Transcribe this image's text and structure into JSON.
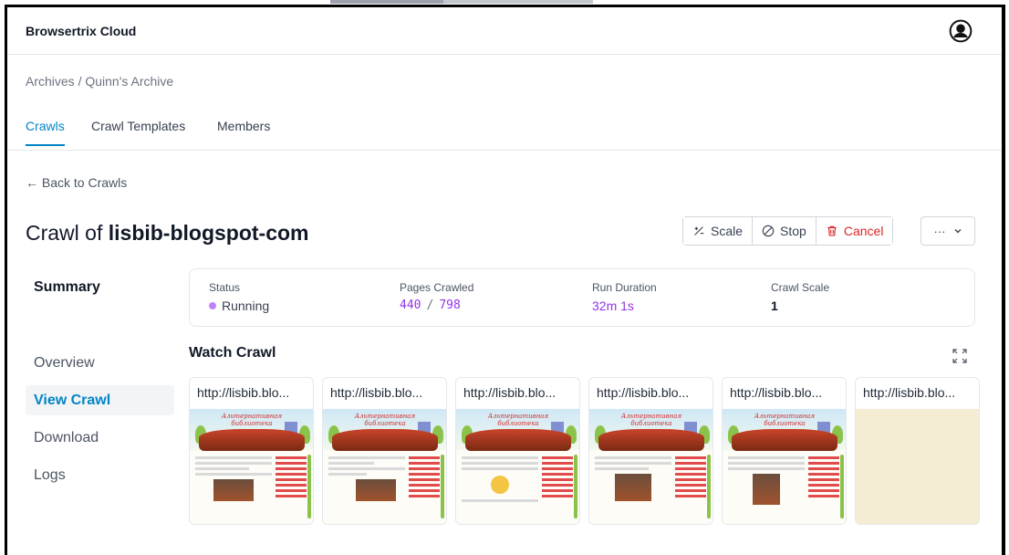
{
  "app": {
    "title": "Browsertrix Cloud"
  },
  "breadcrumb": "Archives / Quinn's Archive",
  "tabs": [
    {
      "label": "Crawls"
    },
    {
      "label": "Crawl Templates"
    },
    {
      "label": "Members"
    }
  ],
  "back_link": "← Back to Crawls",
  "page": {
    "title_prefix": "Crawl of ",
    "title_name": "lisbib-blogspot-com"
  },
  "actions": {
    "scale": "Scale",
    "stop": "Stop",
    "cancel": "Cancel",
    "more": "···"
  },
  "sidebar": {
    "heading": "Summary",
    "items": [
      {
        "label": "Overview"
      },
      {
        "label": "View Crawl"
      },
      {
        "label": "Download"
      },
      {
        "label": "Logs"
      }
    ]
  },
  "summary": {
    "status_label": "Status",
    "status_value": "Running",
    "pages_label": "Pages Crawled",
    "pages_done": "440",
    "pages_sep": "/",
    "pages_total": "798",
    "duration_label": "Run Duration",
    "duration_value": "32m 1s",
    "scale_label": "Crawl Scale",
    "scale_value": "1"
  },
  "watch": {
    "title": "Watch Crawl",
    "screens": [
      {
        "url": "http://lisbib.blo..."
      },
      {
        "url": "http://lisbib.blo..."
      },
      {
        "url": "http://lisbib.blo..."
      },
      {
        "url": "http://lisbib.blo..."
      },
      {
        "url": "http://lisbib.blo..."
      },
      {
        "url": "http://lisbib.blo..."
      }
    ]
  },
  "colors": {
    "accent": "#0284c7",
    "danger": "#dc2626",
    "running": "#c084fc",
    "purple_text": "#9333ea"
  }
}
